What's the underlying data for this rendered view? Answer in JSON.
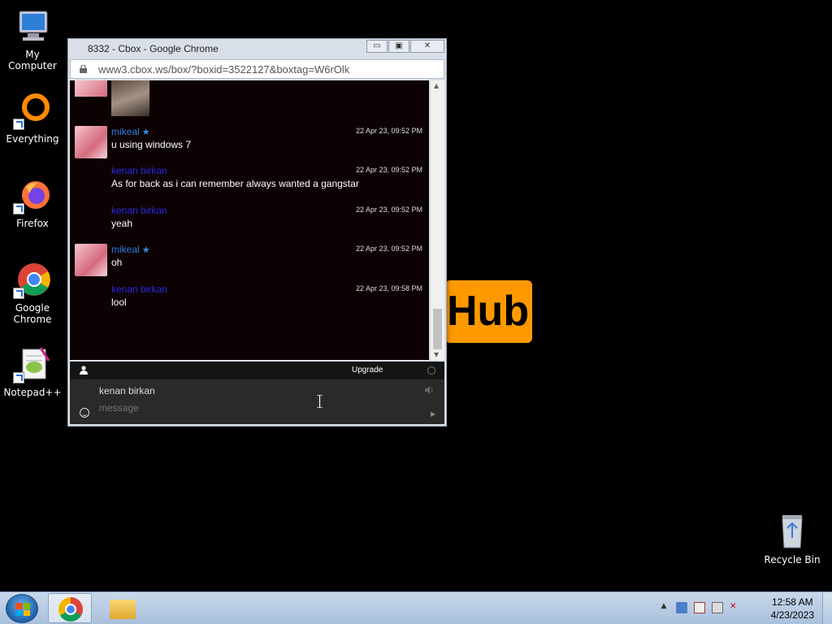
{
  "desktop": {
    "icons": [
      {
        "label": "My Computer"
      },
      {
        "label": "Everything"
      },
      {
        "label": "Firefox"
      },
      {
        "label": "Google Chrome"
      },
      {
        "label": "Notepad++"
      }
    ],
    "recycle_bin": "Recycle Bin",
    "background_logo_text": "Hub"
  },
  "window": {
    "title": "8332 - Cbox - Google Chrome",
    "url": "www3.cbox.ws/box/?boxid=3522127&boxtag=W6rOlk"
  },
  "chat": {
    "messages": [
      {
        "name": "mikeal",
        "time": "22 Apr 23, 09:52 PM",
        "text": "u using windows 7"
      },
      {
        "name": "kenan birkan",
        "time": "22 Apr 23, 09:52 PM",
        "text": "As for back as i can remember always wanted a gangstar"
      },
      {
        "name": "kenan birkan",
        "time": "22 Apr 23, 09:52 PM",
        "text": "yeah"
      },
      {
        "name": "mikeal",
        "time": "22 Apr 23, 09:52 PM",
        "text": "oh"
      },
      {
        "name": "kenan birkan",
        "time": "22 Apr 23, 09:58 PM",
        "text": "lool"
      }
    ],
    "upgrade_label": "Upgrade",
    "username": "kenan birkan",
    "message_placeholder": "message"
  },
  "taskbar": {
    "time": "12:58 AM",
    "date": "4/23/2023"
  }
}
